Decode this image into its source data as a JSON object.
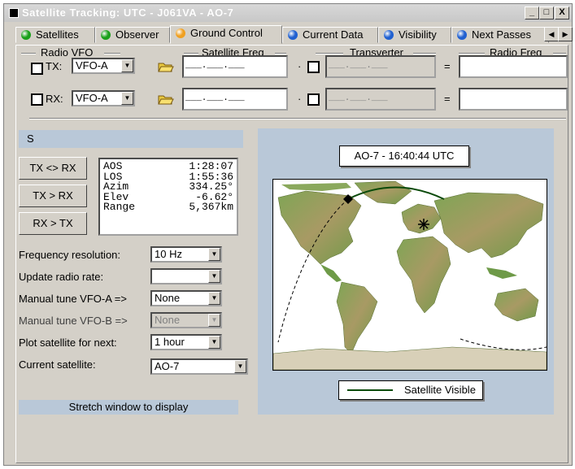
{
  "window": {
    "title": "Satellite Tracking: UTC - J061VA - AO-7",
    "controls": {
      "minimize": "_",
      "maximize": "□",
      "close": "X"
    }
  },
  "tabs": [
    {
      "label": "Satellites",
      "dot_color": "#1aa01a"
    },
    {
      "label": "Observer",
      "dot_color": "#1aa01a"
    },
    {
      "label": "Ground Control",
      "dot_color": "#f0a020"
    },
    {
      "label": "Current Data",
      "dot_color": "#2060d0"
    },
    {
      "label": "Visibility",
      "dot_color": "#2060d0"
    },
    {
      "label": "Next Passes",
      "dot_color": "#2060d0"
    }
  ],
  "tab_scroll": {
    "left": "◀",
    "right": "▶"
  },
  "groups": {
    "radio_vfo": "Radio VFO",
    "satellite_freq": "Satellite Freq",
    "transverter": "Transverter",
    "radio_freq": "Radio Freq"
  },
  "tx_row": {
    "label": "TX:",
    "vfo": "VFO-A",
    "sat_freq": "___.___.___",
    "operator": "·",
    "equals": "="
  },
  "rx_row": {
    "label": "RX:",
    "vfo": "VFO-A",
    "sat_freq": "___.___.___",
    "operator": "·",
    "equals": "="
  },
  "transverter_freq": "___.___.___",
  "status_box": "S",
  "buttons": {
    "swap": "TX <> RX",
    "tx_to_rx": "TX > RX",
    "rx_to_tx": "RX > TX"
  },
  "current_data": [
    {
      "key": "AOS",
      "value": "1:28:07"
    },
    {
      "key": "LOS",
      "value": "1:55:36"
    },
    {
      "key": "Azim",
      "value": "334.25°"
    },
    {
      "key": "Elev",
      "value": "-6.62°"
    },
    {
      "key": "Range",
      "value": "5,367km"
    }
  ],
  "settings": [
    {
      "label": "Frequency resolution:",
      "value": "10 Hz",
      "disabled": false
    },
    {
      "label": "Update radio rate:",
      "value": "",
      "disabled": false
    },
    {
      "label": "Manual tune VFO-A =>",
      "value": "None",
      "disabled": false
    },
    {
      "label": "Manual tune VFO-B =>",
      "value": "None",
      "disabled": true
    },
    {
      "label": "Plot satellite for next:",
      "value": "1 hour",
      "disabled": false
    },
    {
      "label": "Current satellite:",
      "value": "AO-7",
      "disabled": false
    }
  ],
  "stretch_note": "Stretch window to display",
  "map": {
    "header": "AO-7  -  16:40:44 UTC",
    "legend": "Satellite Visible",
    "colors": {
      "ocean": "#ffffff",
      "land_low": "#6e9a48",
      "land_high": "#b89a6a",
      "track_visible": "#0a4a0a",
      "track_hidden": "#000000"
    }
  }
}
